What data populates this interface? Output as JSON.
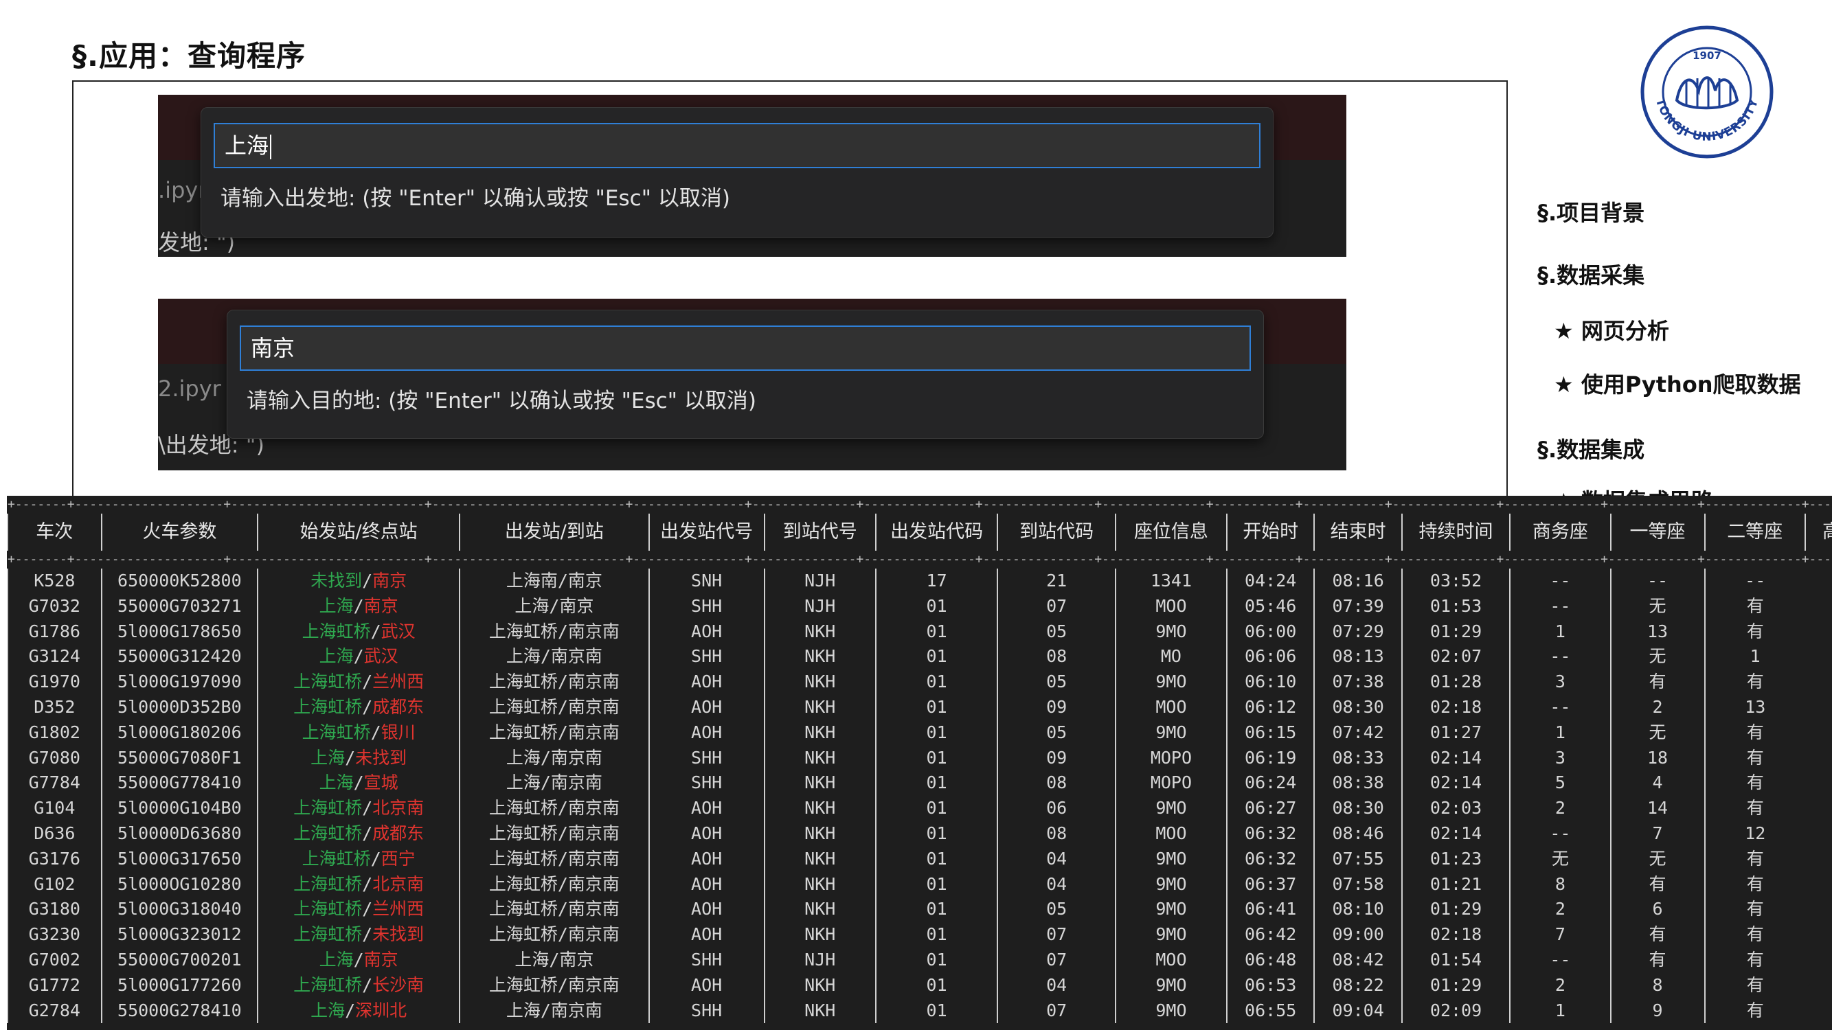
{
  "slide": {
    "title": "§.应用：查询程序"
  },
  "sidebar": {
    "items": [
      {
        "label": "§.项目背景",
        "kind": "section"
      },
      {
        "label": "§.数据采集",
        "kind": "section"
      },
      {
        "label": "★ 网页分析",
        "kind": "sub"
      },
      {
        "label": "★ 使用Python爬取数据",
        "kind": "sub"
      },
      {
        "label": "§.数据集成",
        "kind": "section"
      },
      {
        "label": "★ 数据集成思路",
        "kind": "sub"
      }
    ]
  },
  "logo": {
    "year": "1907",
    "name": "TONGJI UNIVERSITY",
    "colors": {
      "ink": "#1d3f95"
    }
  },
  "screenshot1": {
    "input_value": "上海",
    "hint": "请输入出发地:  (按 \"Enter\" 以确认或按 \"Esc\" 以取消)",
    "bg_file": ".ipyr",
    "bg_text": "发地: \")"
  },
  "screenshot2": {
    "input_value": "南京",
    "hint": "请输入目的地:  (按 \"Enter\" 以确认或按 \"Esc\" 以取消)",
    "bg_file": "2.ipyr",
    "bg_text": "\\出发地: \")"
  },
  "colors": {
    "start_station": "#2fa84f",
    "end_station": "#e0342f",
    "console_bg": "#1e1e1e",
    "input_border": "#2f7fd6"
  },
  "table": {
    "headers": [
      "车次",
      "火车参数",
      "始发站/终点站",
      "出发站/到站",
      "出发站代号",
      "到站代号",
      "出发站代码",
      "到站代码",
      "座位信息",
      "开始时",
      "结束时",
      "持续时间",
      "商务座",
      "一等座",
      "二等座",
      "高级软卧"
    ],
    "rows": [
      [
        "K528",
        "650000K52800",
        "未找到",
        "南京",
        "上海南/南京",
        "SNH",
        "NJH",
        "17",
        "21",
        "1341",
        "04:24",
        "08:16",
        "03:52",
        "--",
        "--",
        "--"
      ],
      [
        "G7032",
        "55000G703271",
        "上海",
        "南京",
        "上海/南京",
        "SHH",
        "NJH",
        "01",
        "07",
        "MOO",
        "05:46",
        "07:39",
        "01:53",
        "--",
        "无",
        "有"
      ],
      [
        "G1786",
        "5l000G178650",
        "上海虹桥",
        "武汉",
        "上海虹桥/南京南",
        "AOH",
        "NKH",
        "01",
        "05",
        "9MO",
        "06:00",
        "07:29",
        "01:29",
        "1",
        "13",
        "有"
      ],
      [
        "G3124",
        "55000G312420",
        "上海",
        "武汉",
        "上海/南京南",
        "SHH",
        "NKH",
        "01",
        "08",
        "MO",
        "06:06",
        "08:13",
        "02:07",
        "--",
        "无",
        "1"
      ],
      [
        "G1970",
        "5l000G197090",
        "上海虹桥",
        "兰州西",
        "上海虹桥/南京南",
        "AOH",
        "NKH",
        "01",
        "05",
        "9MO",
        "06:10",
        "07:38",
        "01:28",
        "3",
        "有",
        "有"
      ],
      [
        "D352",
        "5l0000D352B0",
        "上海虹桥",
        "成都东",
        "上海虹桥/南京南",
        "AOH",
        "NKH",
        "01",
        "09",
        "MOO",
        "06:12",
        "08:30",
        "02:18",
        "--",
        "2",
        "13"
      ],
      [
        "G1802",
        "5l000G180206",
        "上海虹桥",
        "银川",
        "上海虹桥/南京南",
        "AOH",
        "NKH",
        "01",
        "05",
        "9MO",
        "06:15",
        "07:42",
        "01:27",
        "1",
        "无",
        "有"
      ],
      [
        "G7080",
        "55000G7080F1",
        "上海",
        "未找到",
        "上海/南京南",
        "SHH",
        "NKH",
        "01",
        "09",
        "MOPO",
        "06:19",
        "08:33",
        "02:14",
        "3",
        "18",
        "有"
      ],
      [
        "G7784",
        "55000G778410",
        "上海",
        "宣城",
        "上海/南京南",
        "SHH",
        "NKH",
        "01",
        "08",
        "MOPO",
        "06:24",
        "08:38",
        "02:14",
        "5",
        "4",
        "有"
      ],
      [
        "G104",
        "5l0000G104B0",
        "上海虹桥",
        "北京南",
        "上海虹桥/南京南",
        "AOH",
        "NKH",
        "01",
        "06",
        "9MO",
        "06:27",
        "08:30",
        "02:03",
        "2",
        "14",
        "有"
      ],
      [
        "D636",
        "5l0000D63680",
        "上海虹桥",
        "成都东",
        "上海虹桥/南京南",
        "AOH",
        "NKH",
        "01",
        "08",
        "MOO",
        "06:32",
        "08:46",
        "02:14",
        "--",
        "7",
        "12"
      ],
      [
        "G3176",
        "5l000G317650",
        "上海虹桥",
        "西宁",
        "上海虹桥/南京南",
        "AOH",
        "NKH",
        "01",
        "04",
        "9MO",
        "06:32",
        "07:55",
        "01:23",
        "无",
        "无",
        "有"
      ],
      [
        "G102",
        "5l000OG10280",
        "上海虹桥",
        "北京南",
        "上海虹桥/南京南",
        "AOH",
        "NKH",
        "01",
        "04",
        "9MO",
        "06:37",
        "07:58",
        "01:21",
        "8",
        "有",
        "有"
      ],
      [
        "G3180",
        "5l000G318040",
        "上海虹桥",
        "兰州西",
        "上海虹桥/南京南",
        "AOH",
        "NKH",
        "01",
        "05",
        "9MO",
        "06:41",
        "08:10",
        "01:29",
        "2",
        "6",
        "有"
      ],
      [
        "G3230",
        "5l000G323012",
        "上海虹桥",
        "未找到",
        "上海虹桥/南京南",
        "AOH",
        "NKH",
        "01",
        "07",
        "9MO",
        "06:42",
        "09:00",
        "02:18",
        "7",
        "有",
        "有"
      ],
      [
        "G7002",
        "55000G700201",
        "上海",
        "南京",
        "上海/南京",
        "SHH",
        "NJH",
        "01",
        "07",
        "MOO",
        "06:48",
        "08:42",
        "01:54",
        "--",
        "有",
        "有"
      ],
      [
        "G1772",
        "5l000G177260",
        "上海虹桥",
        "长沙南",
        "上海虹桥/南京南",
        "AOH",
        "NKH",
        "01",
        "04",
        "9MO",
        "06:53",
        "08:22",
        "01:29",
        "2",
        "8",
        "有"
      ],
      [
        "G2784",
        "55000G278410",
        "上海",
        "深圳北",
        "上海/南京南",
        "SHH",
        "NKH",
        "01",
        "07",
        "9MO",
        "06:55",
        "09:04",
        "02:09",
        "1",
        "9",
        "有"
      ]
    ]
  }
}
